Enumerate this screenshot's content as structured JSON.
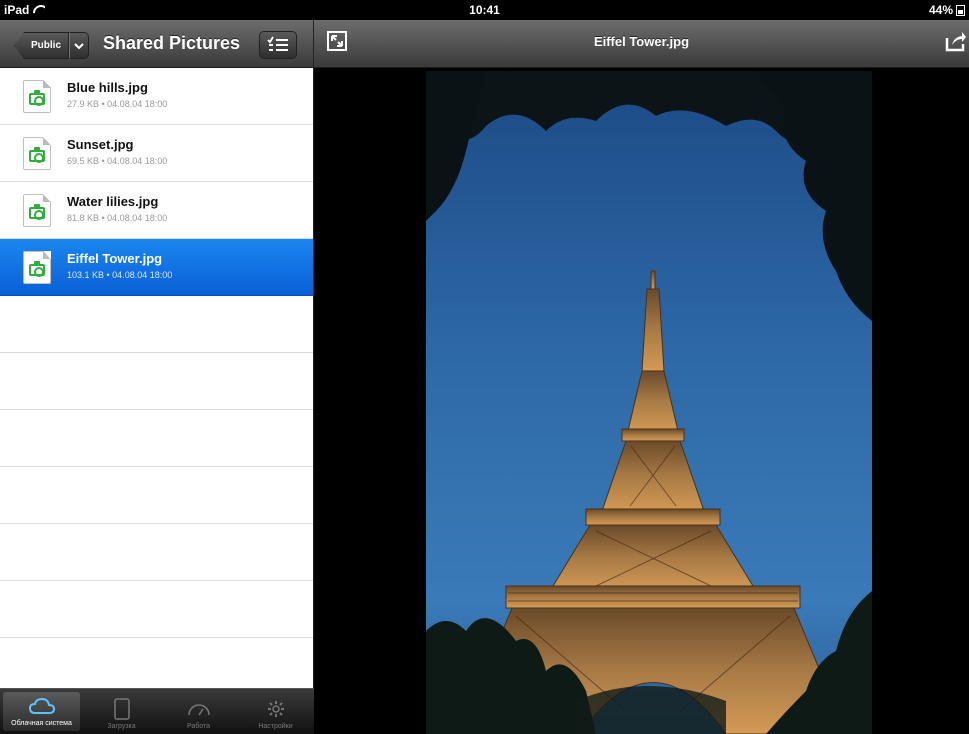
{
  "status_bar": {
    "device": "iPad",
    "time": "10:41",
    "battery": "44%"
  },
  "left_nav": {
    "back_label": "Public",
    "title": "Shared Pictures"
  },
  "files": [
    {
      "name": "Blue hills.jpg",
      "meta": "27.9 KB • 04.08.04 18:00",
      "selected": false
    },
    {
      "name": "Sunset.jpg",
      "meta": "69.5 KB • 04.08.04 18:00",
      "selected": false
    },
    {
      "name": "Water lilies.jpg",
      "meta": "81.8 KB • 04.08.04 18:00",
      "selected": false
    },
    {
      "name": "Eiffel Tower.jpg",
      "meta": "103.1 KB • 04.08.04 18:00",
      "selected": true
    }
  ],
  "tabs": [
    {
      "label": "Облачная система",
      "icon": "cloud-icon",
      "active": true
    },
    {
      "label": "Загрузка",
      "icon": "tablet-icon",
      "active": false
    },
    {
      "label": "Работа",
      "icon": "speedometer-icon",
      "active": false
    },
    {
      "label": "Настройки",
      "icon": "gear-icon",
      "active": false
    }
  ],
  "viewer": {
    "title": "Eiffel Tower.jpg"
  },
  "colors": {
    "selection": "#1b86f0",
    "file_icon_accent": "#2fae3e",
    "navbar": "#4a4a4a"
  }
}
